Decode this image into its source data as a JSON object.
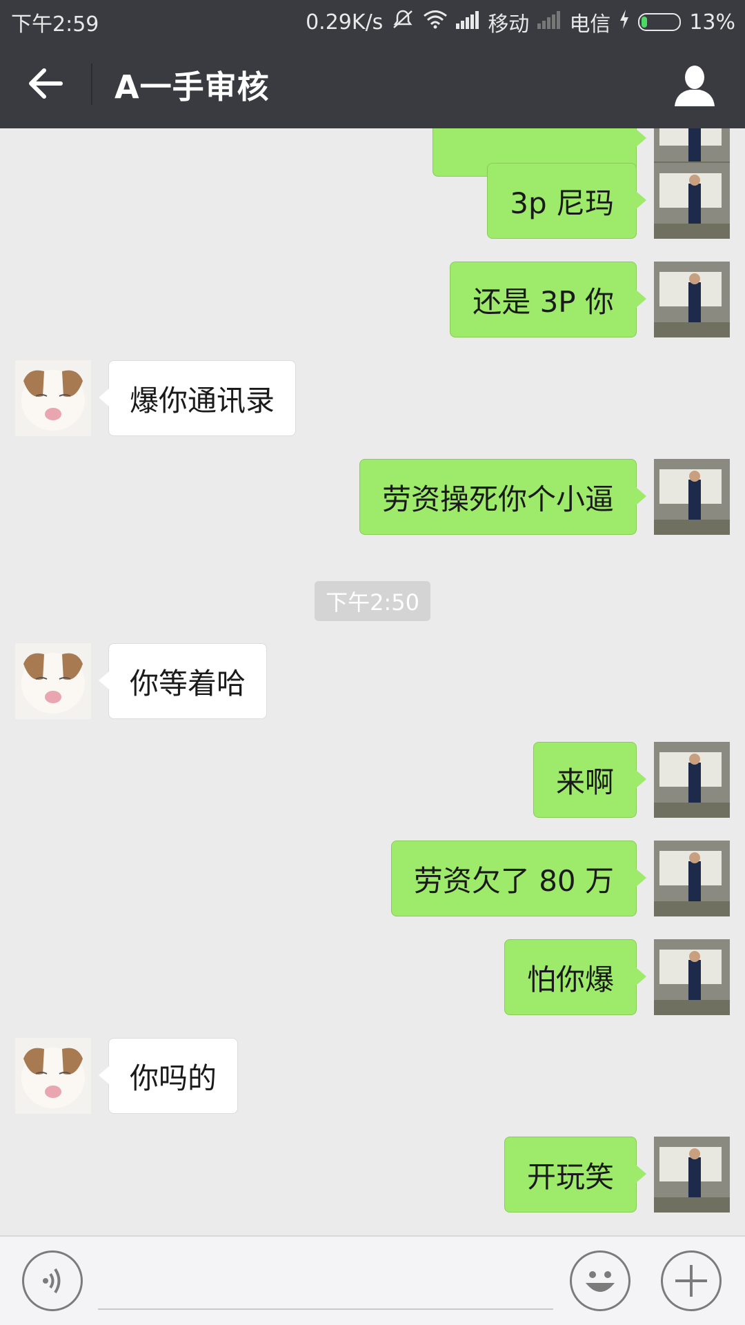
{
  "status_bar": {
    "time": "下午2:59",
    "net_speed": "0.29K/s",
    "carrier1": "移动",
    "carrier2": "电信",
    "battery": "13%"
  },
  "header": {
    "title": "A一手审核",
    "back_icon": "arrow-left-icon",
    "profile_icon": "person-icon"
  },
  "messages": [
    {
      "sender": "me",
      "text": "3p 尼玛"
    },
    {
      "sender": "me",
      "text": "还是 3P 你"
    },
    {
      "sender": "them",
      "text": "爆你通讯录"
    },
    {
      "sender": "me",
      "text": "劳资操死你个小逼"
    },
    {
      "sender": "system",
      "text": "下午2:50"
    },
    {
      "sender": "them",
      "text": "你等着哈"
    },
    {
      "sender": "me",
      "text": "来啊"
    },
    {
      "sender": "me",
      "text": "劳资欠了 80 万"
    },
    {
      "sender": "me",
      "text": "怕你爆"
    },
    {
      "sender": "them",
      "text": "你吗的"
    },
    {
      "sender": "me",
      "text": "开玩笑"
    }
  ],
  "input_bar": {
    "voice_icon": "voice-icon",
    "emoji_icon": "emoji-icon",
    "plus_icon": "plus-icon",
    "input_value": ""
  },
  "colors": {
    "header_bg": "#3a3b40",
    "chat_bg": "#ebebeb",
    "my_bubble": "#9eea6a",
    "their_bubble": "#ffffff"
  }
}
